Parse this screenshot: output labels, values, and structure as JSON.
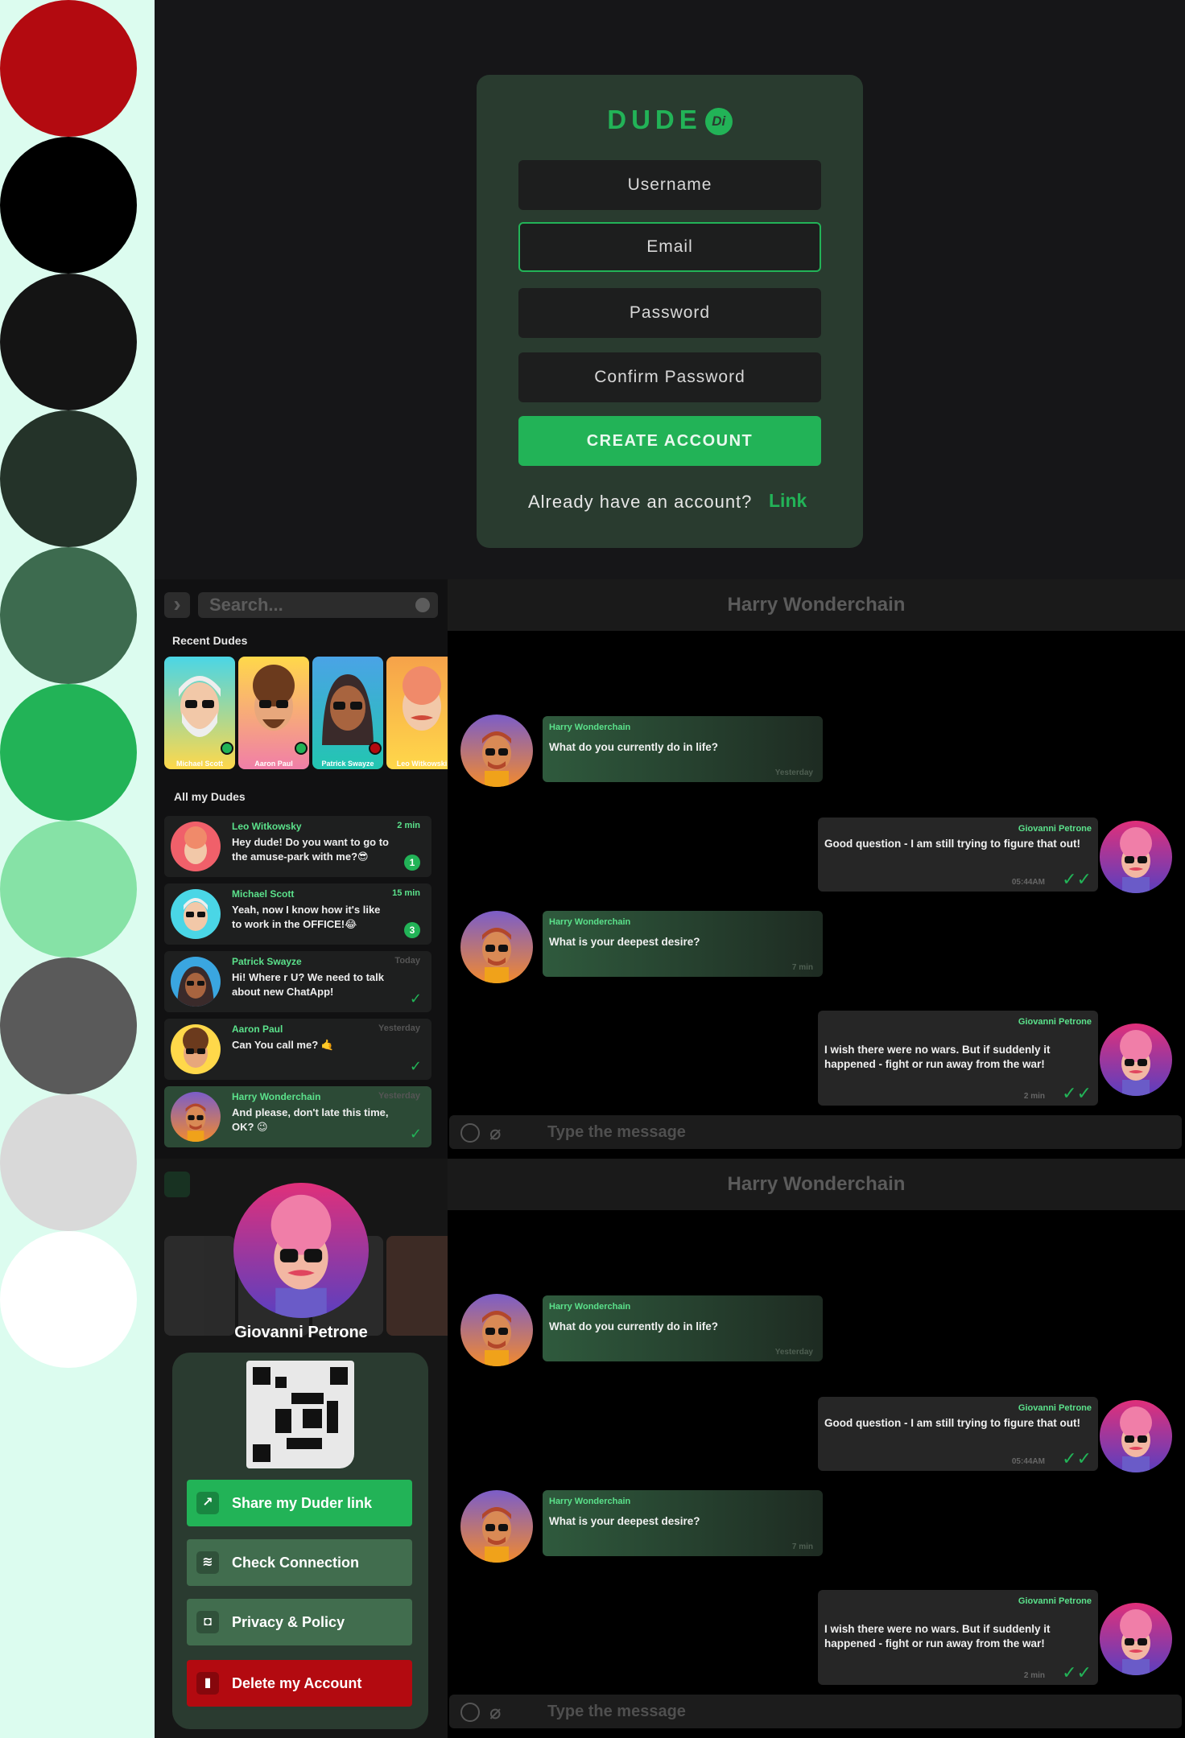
{
  "palette": {
    "colors": [
      "#b30a10",
      "#000000",
      "#141414",
      "#243329",
      "#3d6b4f",
      "#22b357",
      "#86e2a6",
      "#5a5a5a",
      "#d9d9d9",
      "#ffffff"
    ]
  },
  "signup": {
    "logo": "DUDE",
    "logo_mark": "Di",
    "fields": {
      "username": "Username",
      "email": "Email",
      "password": "Password",
      "confirm": "Confirm Password"
    },
    "create_label": "CREATE ACCOUNT",
    "already_text": "Already have an account?",
    "link_label": "Link"
  },
  "sidebar": {
    "search_placeholder": "Search...",
    "recent_title": "Recent Dudes",
    "all_title": "All my Dudes",
    "recent": [
      {
        "name": "Michael Scott",
        "status": "online"
      },
      {
        "name": "Aaron Paul",
        "status": "online"
      },
      {
        "name": "Patrick Swayze",
        "status": "busy"
      },
      {
        "name": "Leo Witkowski",
        "status": "none"
      }
    ],
    "chats": [
      {
        "name": "Leo Witkowsky",
        "time": "2 min",
        "msg": "Hey dude! Do you want to go to the amuse-park with me?😎",
        "badge": "1"
      },
      {
        "name": "Michael Scott",
        "time": "15 min",
        "msg": "Yeah, now I know how it's like to work in the OFFICE!😂",
        "badge": "3"
      },
      {
        "name": "Patrick Swayze",
        "time": "Today",
        "msg": "Hi! Where r U? We need to talk about new ChatApp!",
        "read": "✓"
      },
      {
        "name": "Aaron Paul",
        "time": "Yesterday",
        "msg": "Can You call me? 🤙",
        "read": "✓"
      },
      {
        "name": "Harry Wonderchain",
        "time": "Yesterday",
        "msg": "And please, don't late this time, OK? 😉",
        "read": "✓"
      }
    ]
  },
  "profile": {
    "name": "Giovanni Petrone",
    "share": "Share my Duder link",
    "check": "Check Connection",
    "privacy": "Privacy & Policy",
    "delete": "Delete my Account"
  },
  "chat": {
    "title": "Harry Wonderchain",
    "input_placeholder": "Type the message",
    "messages": [
      {
        "dir": "in",
        "name": "Harry Wonderchain",
        "text": "What do you currently do in life?",
        "time": "Yesterday"
      },
      {
        "dir": "out",
        "name": "Giovanni Petrone",
        "text": "Good question - I am still trying to figure that out!",
        "time": "05:44AM"
      },
      {
        "dir": "in",
        "name": "Harry Wonderchain",
        "text": "What is your deepest desire?",
        "time": "7 min"
      },
      {
        "dir": "out",
        "name": "Giovanni Petrone",
        "text": "I wish there were no wars. But if suddenly it happened - fight or run away from the war!",
        "time": "2 min"
      }
    ]
  }
}
